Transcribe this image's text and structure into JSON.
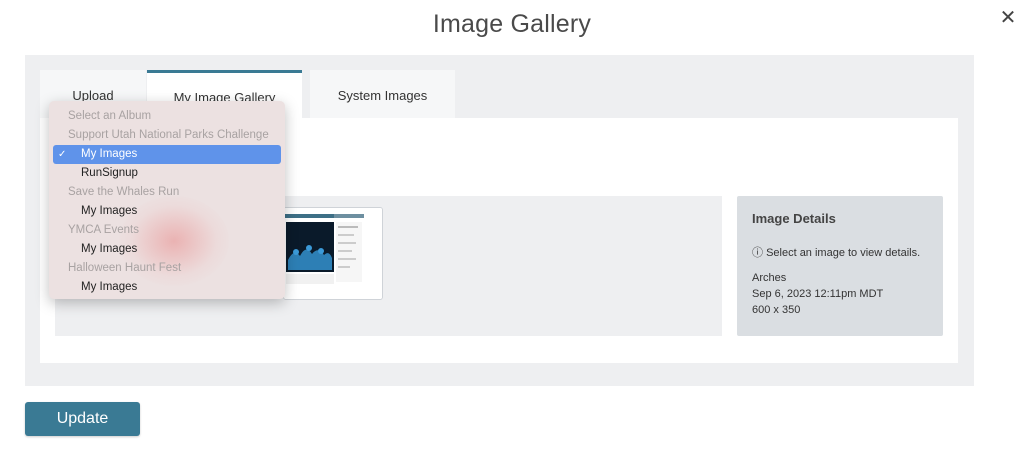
{
  "dialog": {
    "title": "Image Gallery",
    "close_symbol": "✕"
  },
  "tabs": [
    {
      "label": "Upload",
      "active": false
    },
    {
      "label": "My Image Gallery",
      "active": true
    },
    {
      "label": "System Images",
      "active": false
    }
  ],
  "album_dropdown": {
    "check_mark": "✓",
    "options": [
      {
        "label": "Select an Album",
        "type": "group"
      },
      {
        "label": "Support Utah National Parks Challenge",
        "type": "group"
      },
      {
        "label": "My Images",
        "type": "item",
        "selected": true
      },
      {
        "label": "RunSignup",
        "type": "item"
      },
      {
        "label": "Save the Whales Run",
        "type": "group"
      },
      {
        "label": "My Images",
        "type": "item"
      },
      {
        "label": "YMCA Events",
        "type": "group"
      },
      {
        "label": "My Images",
        "type": "item"
      },
      {
        "label": "Halloween Haunt Fest",
        "type": "group"
      },
      {
        "label": "My Images",
        "type": "item"
      }
    ]
  },
  "image_details": {
    "heading": "Image Details",
    "info_icon": "ⓘ",
    "hint": "Select an image to view details.",
    "name": "Arches",
    "date": "Sep 6, 2023 12:11pm MDT",
    "dimensions": "600 x 350"
  },
  "footer": {
    "update_label": "Update"
  },
  "colors": {
    "accent": "#3a7a94",
    "selected_option": "#5f93ea"
  }
}
